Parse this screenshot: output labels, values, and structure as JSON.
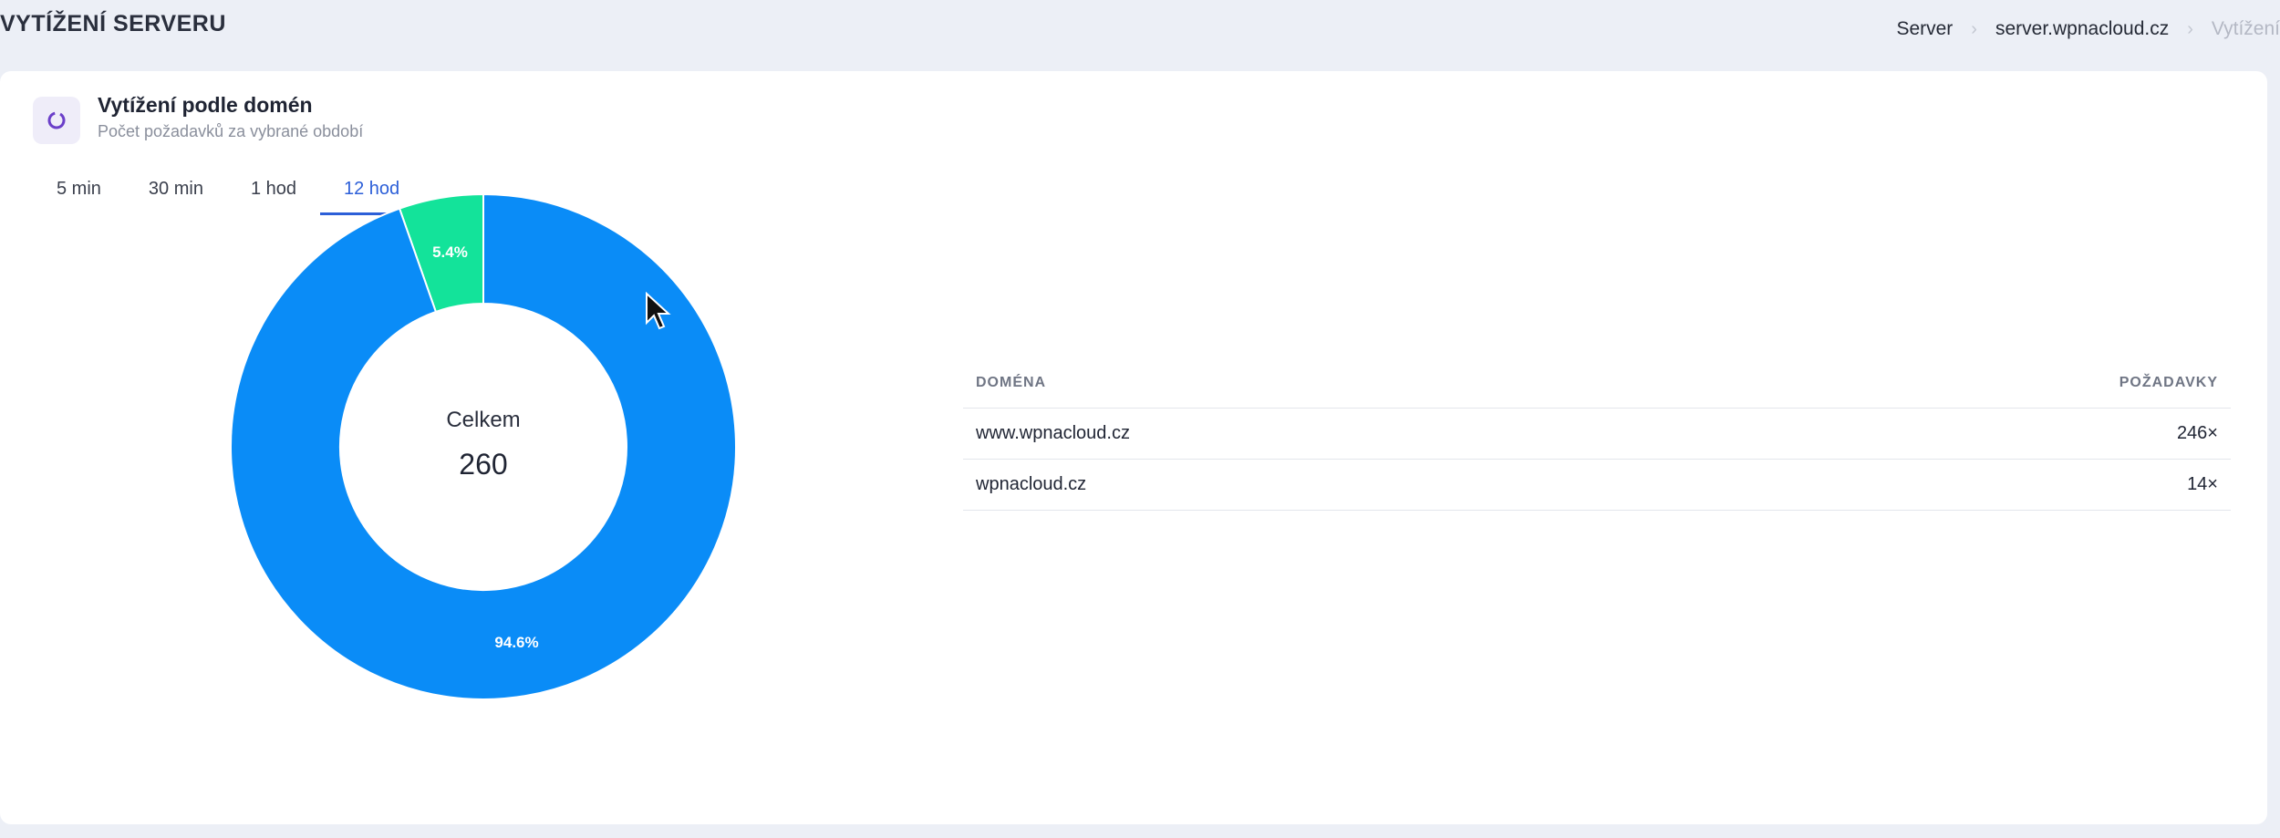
{
  "header": {
    "title": "VYTÍŽENÍ SERVERU",
    "breadcrumb": [
      "Server",
      "server.wpnacloud.cz",
      "Vytížení"
    ]
  },
  "card": {
    "title": "Vytížení podle domén",
    "subtitle": "Počet požadavků za vybrané období",
    "icon": "donut-icon",
    "tabs": [
      {
        "label": "5 min",
        "active": false
      },
      {
        "label": "30 min",
        "active": false
      },
      {
        "label": "1 hod",
        "active": false
      },
      {
        "label": "12 hod",
        "active": true
      }
    ]
  },
  "chart_data": {
    "type": "pie",
    "categories": [
      "www.wpnacloud.cz",
      "wpnacloud.cz"
    ],
    "values": [
      246,
      14
    ],
    "slice_labels": [
      "94.6%",
      "5.4%"
    ],
    "center_label": "Celkem",
    "center_value": "260",
    "colors": [
      "#0a8cf7",
      "#13e39a"
    ]
  },
  "table": {
    "headers": [
      "DOMÉNA",
      "POŽADAVKY"
    ],
    "rows": [
      {
        "domain": "www.wpnacloud.cz",
        "requests": "246×"
      },
      {
        "domain": "wpnacloud.cz",
        "requests": "14×"
      }
    ]
  },
  "colors": {
    "accent": "#2c5fd8",
    "background": "#eceff6"
  }
}
